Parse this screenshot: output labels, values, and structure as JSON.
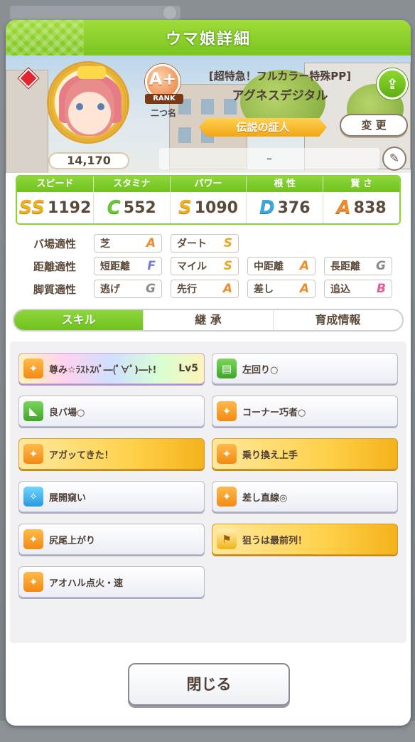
{
  "header": {
    "title": "ウマ娘詳細"
  },
  "character": {
    "outfit": "[超特急！フルカラー特殊PP]",
    "name": "アグネスデジタル",
    "fans": "14,170",
    "rank": {
      "grade": "A+",
      "label": "RANK",
      "title": "二つ名"
    },
    "epithet": "伝説の証人",
    "comment": "–",
    "change_label": "変 更"
  },
  "stats": [
    {
      "label": "スピード",
      "grade": "SS",
      "value": "1192",
      "grade_color": "#f0b020"
    },
    {
      "label": "スタミナ",
      "grade": "C",
      "value": "552",
      "grade_color": "#6dc63a"
    },
    {
      "label": "パワー",
      "grade": "S",
      "value": "1090",
      "grade_color": "#f0b020"
    },
    {
      "label": "根 性",
      "grade": "D",
      "value": "376",
      "grade_color": "#3fa7e0"
    },
    {
      "label": "賢 さ",
      "grade": "A",
      "value": "838",
      "grade_color": "#f08a2a"
    }
  ],
  "aptitudes": {
    "surface": {
      "label": "バ場適性",
      "items": [
        {
          "name": "芝",
          "grade": "A"
        },
        {
          "name": "ダート",
          "grade": "S"
        }
      ]
    },
    "distance": {
      "label": "距離適性",
      "items": [
        {
          "name": "短距離",
          "grade": "F"
        },
        {
          "name": "マイル",
          "grade": "S"
        },
        {
          "name": "中距離",
          "grade": "A"
        },
        {
          "name": "長距離",
          "grade": "G"
        }
      ]
    },
    "style": {
      "label": "脚質適性",
      "items": [
        {
          "name": "逃げ",
          "grade": "G"
        },
        {
          "name": "先行",
          "grade": "A"
        },
        {
          "name": "差し",
          "grade": "A"
        },
        {
          "name": "追込",
          "grade": "B"
        }
      ]
    }
  },
  "tabs": [
    "スキル",
    "継 承",
    "育成情報"
  ],
  "skills": [
    {
      "name": "尊み☆ﾗｽﾄｽﾊﾟ―(ﾟ∀ﾟ)―ﾄ!",
      "level": "Lv5",
      "type": "unique",
      "icon": "running-icon"
    },
    {
      "name": "左回り○",
      "level": "",
      "type": "normal",
      "icon": "track-icon"
    },
    {
      "name": "良バ場○",
      "level": "",
      "type": "normal",
      "icon": "power-icon"
    },
    {
      "name": "コーナー巧者○",
      "level": "",
      "type": "normal",
      "icon": "running-icon"
    },
    {
      "name": "アガッてきた！",
      "level": "",
      "type": "gold",
      "icon": "running-icon"
    },
    {
      "name": "乗り換え上手",
      "level": "",
      "type": "gold",
      "icon": "running-icon"
    },
    {
      "name": "展開窺い",
      "level": "",
      "type": "normal",
      "icon": "sparkle-icon"
    },
    {
      "name": "差し直線◎",
      "level": "",
      "type": "normal",
      "icon": "running-icon"
    },
    {
      "name": "尻尾上がり",
      "level": "",
      "type": "normal",
      "icon": "running-icon"
    },
    {
      "name": "狙うは最前列！",
      "level": "",
      "type": "gold",
      "icon": "flag-icon"
    },
    {
      "name": "アオハル点火・速",
      "level": "",
      "type": "normal",
      "icon": "running-icon"
    }
  ],
  "close_label": "閉じる"
}
